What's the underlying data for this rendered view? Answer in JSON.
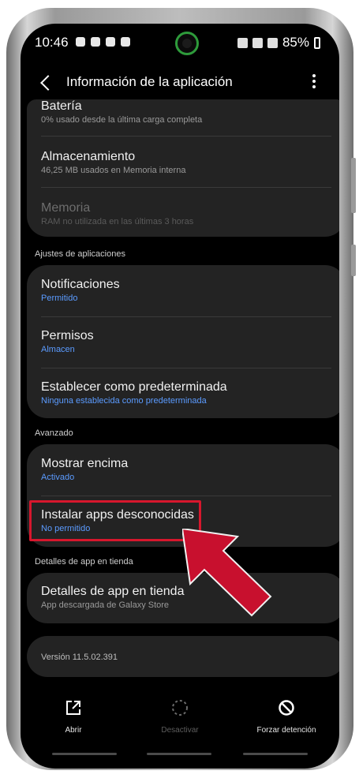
{
  "status": {
    "time": "10:46",
    "battery": "85%"
  },
  "appbar": {
    "title": "Información de la aplicación"
  },
  "usage": {
    "items": [
      {
        "title": "Batería",
        "subtitle": "0% usado desde la última carga completa"
      },
      {
        "title": "Almacenamiento",
        "subtitle": "46,25 MB usados en Memoria interna"
      },
      {
        "title": "Memoria",
        "subtitle": "RAM no utilizada en las últimas 3 horas"
      }
    ]
  },
  "app_settings": {
    "header": "Ajustes de aplicaciones",
    "items": [
      {
        "title": "Notificaciones",
        "subtitle": "Permitido"
      },
      {
        "title": "Permisos",
        "subtitle": "Almacen"
      },
      {
        "title": "Establecer como predeterminada",
        "subtitle": "Ninguna establecida como predeterminada"
      }
    ]
  },
  "advanced": {
    "header": "Avanzado",
    "items": [
      {
        "title": "Mostrar encima",
        "subtitle": "Activado"
      },
      {
        "title": "Instalar apps desconocidas",
        "subtitle": "No permitido"
      }
    ]
  },
  "store": {
    "header": "Detalles de app en tienda",
    "item": {
      "title": "Detalles de app en tienda",
      "subtitle": "App descargada de Galaxy Store"
    }
  },
  "version": {
    "text": "Versión 11.5.02.391"
  },
  "bottom_actions": [
    {
      "label": "Abrir",
      "icon": "open-external-icon"
    },
    {
      "label": "Desactivar",
      "icon": "disable-icon"
    },
    {
      "label": "Forzar detención",
      "icon": "force-stop-icon"
    }
  ],
  "colors": {
    "background": "#000000",
    "card": "#232323",
    "accent_blue": "#5b9bff",
    "highlight_red": "#d7172d"
  }
}
